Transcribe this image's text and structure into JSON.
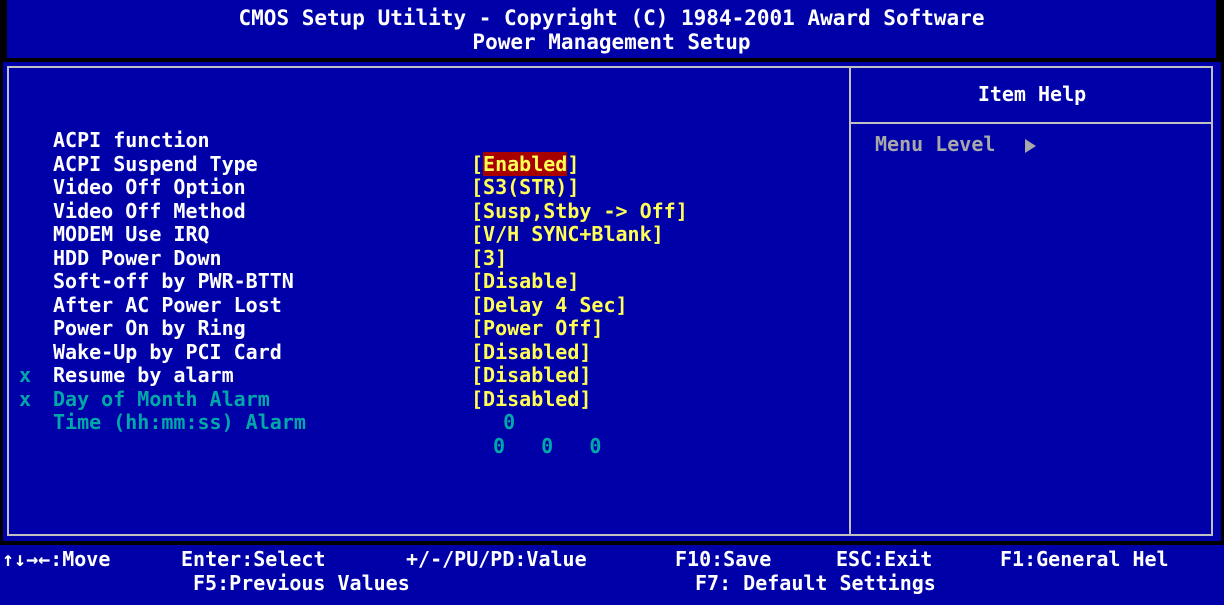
{
  "header": {
    "title_line1": "CMOS Setup Utility - Copyright (C) 1984-2001 Award Software",
    "title_line2": "Power Management Setup"
  },
  "settings": [
    {
      "label": "ACPI function",
      "value": "Enabled",
      "selected": true,
      "disabled": false,
      "marker": ""
    },
    {
      "label": "ACPI Suspend Type",
      "value": "[S3(STR)]",
      "selected": false,
      "disabled": false,
      "marker": ""
    },
    {
      "label": "Video Off Option",
      "value": "[Susp,Stby -> Off]",
      "selected": false,
      "disabled": false,
      "marker": ""
    },
    {
      "label": "Video Off Method",
      "value": "[V/H SYNC+Blank]",
      "selected": false,
      "disabled": false,
      "marker": ""
    },
    {
      "label": "MODEM Use IRQ",
      "value": "[3]",
      "selected": false,
      "disabled": false,
      "marker": ""
    },
    {
      "label": "HDD Power Down",
      "value": "[Disable]",
      "selected": false,
      "disabled": false,
      "marker": ""
    },
    {
      "label": "Soft-off by PWR-BTTN",
      "value": "[Delay 4 Sec]",
      "selected": false,
      "disabled": false,
      "marker": ""
    },
    {
      "label": "After AC Power Lost",
      "value": "[Power Off]",
      "selected": false,
      "disabled": false,
      "marker": ""
    },
    {
      "label": "Power On by Ring",
      "value": "[Disabled]",
      "selected": false,
      "disabled": false,
      "marker": ""
    },
    {
      "label": "Wake-Up by PCI Card",
      "value": "[Disabled]",
      "selected": false,
      "disabled": false,
      "marker": ""
    },
    {
      "label": "Resume by alarm",
      "value": "[Disabled]",
      "selected": false,
      "disabled": false,
      "marker": ""
    },
    {
      "label": "Day of Month Alarm",
      "value": "  0",
      "selected": false,
      "disabled": true,
      "marker": "x"
    },
    {
      "label": "Time (hh:mm:ss) Alarm",
      "value": "0   0   0",
      "selected": false,
      "disabled": true,
      "marker": "x"
    }
  ],
  "help": {
    "title": "Item Help",
    "menu_level": "Menu Level"
  },
  "footer": {
    "move": "↑↓→←:Move",
    "enter": "Enter:Select",
    "value": "+/-/PU/PD:Value",
    "save": "F10:Save",
    "exit": "ESC:Exit",
    "help": "F1:General Hel",
    "prev": "F5:Previous Values",
    "defaults": "F7: Default Settings"
  },
  "colors": {
    "background": "#0000a8",
    "value_text": "#ffff54",
    "disabled_text": "#00a8a8",
    "selection": "#a80000"
  }
}
